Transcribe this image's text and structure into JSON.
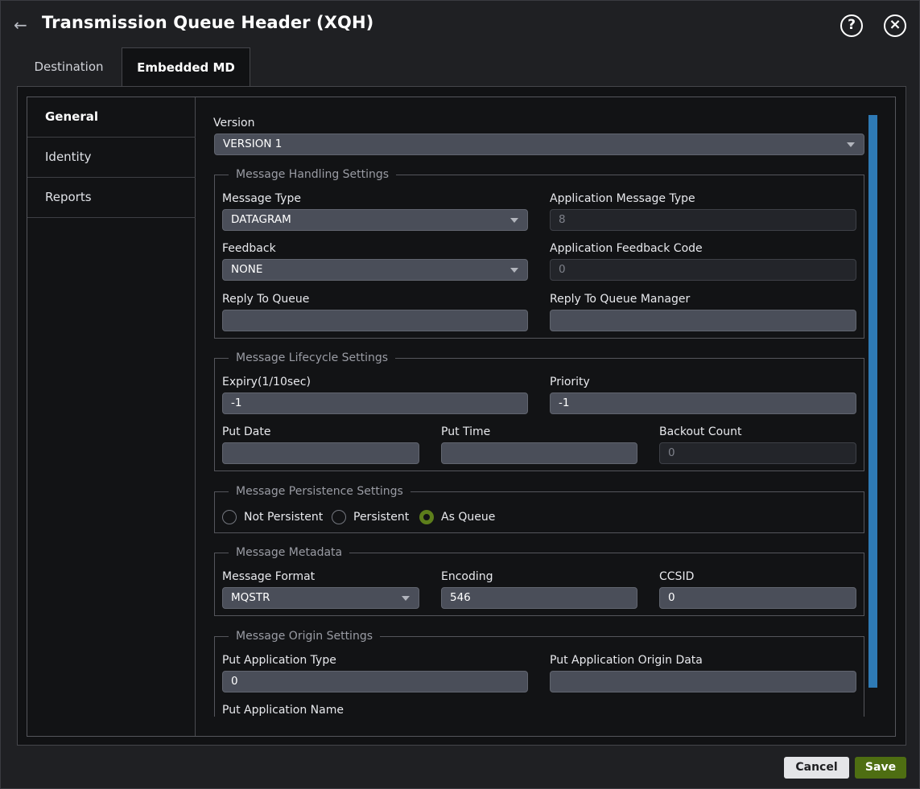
{
  "dialog": {
    "title": "Transmission Queue Header (XQH)",
    "back_icon": "←",
    "help_icon": "?",
    "close_icon": "×"
  },
  "tabs": [
    {
      "label": "Destination",
      "active": false
    },
    {
      "label": "Embedded MD",
      "active": true
    }
  ],
  "side_nav": [
    {
      "label": "General",
      "active": true
    },
    {
      "label": "Identity",
      "active": false
    },
    {
      "label": "Reports",
      "active": false
    }
  ],
  "version": {
    "label": "Version",
    "value": "VERSION 1"
  },
  "handling": {
    "legend": "Message Handling Settings",
    "message_type": {
      "label": "Message Type",
      "value": "DATAGRAM"
    },
    "app_message_type": {
      "label": "Application Message Type",
      "value": "8"
    },
    "feedback": {
      "label": "Feedback",
      "value": "NONE"
    },
    "app_feedback_code": {
      "label": "Application Feedback Code",
      "value": "0"
    },
    "reply_to_queue": {
      "label": "Reply To Queue",
      "value": ""
    },
    "reply_to_qmgr": {
      "label": "Reply To Queue Manager",
      "value": ""
    }
  },
  "lifecycle": {
    "legend": "Message Lifecycle Settings",
    "expiry": {
      "label": "Expiry(1/10sec)",
      "value": "-1"
    },
    "priority": {
      "label": "Priority",
      "value": "-1"
    },
    "put_date": {
      "label": "Put Date",
      "value": ""
    },
    "put_time": {
      "label": "Put Time",
      "value": ""
    },
    "backout_count": {
      "label": "Backout Count",
      "value": "0"
    }
  },
  "persistence": {
    "legend": "Message Persistence Settings",
    "options": [
      {
        "label": "Not Persistent",
        "selected": false
      },
      {
        "label": "Persistent",
        "selected": false
      },
      {
        "label": "As Queue",
        "selected": true
      }
    ]
  },
  "metadata": {
    "legend": "Message Metadata",
    "format": {
      "label": "Message Format",
      "value": "MQSTR"
    },
    "encoding": {
      "label": "Encoding",
      "value": "546"
    },
    "ccsid": {
      "label": "CCSID",
      "value": "0"
    }
  },
  "origin": {
    "legend": "Message Origin Settings",
    "put_app_type": {
      "label": "Put Application Type",
      "value": "0"
    },
    "put_app_origin_data": {
      "label": "Put Application Origin Data",
      "value": ""
    },
    "put_app_name": {
      "label": "Put Application Name"
    }
  },
  "footer": {
    "cancel_label": "Cancel",
    "save_label": "Save"
  },
  "colors": {
    "accent_scroll": "#2e7ab5",
    "save_green": "#4e6e12",
    "radio_selected": "#5d7e1b"
  }
}
